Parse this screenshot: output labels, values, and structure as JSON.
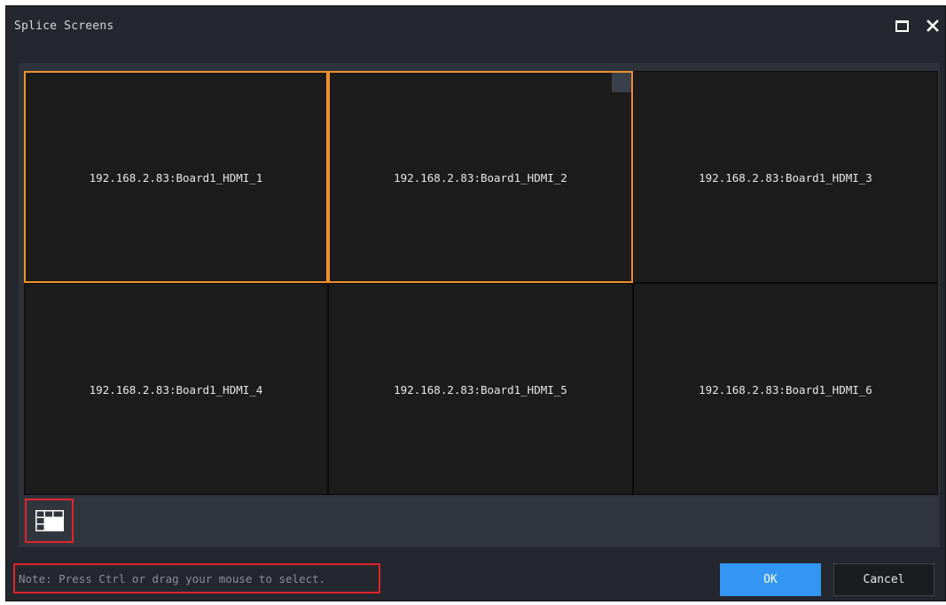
{
  "window": {
    "title": "Splice Screens",
    "maximize_icon": "maximize-icon",
    "close_icon": "close-icon"
  },
  "screens": [
    {
      "label": "192.168.2.83:Board1_HDMI_1",
      "selected": true
    },
    {
      "label": "192.168.2.83:Board1_HDMI_2",
      "selected": true
    },
    {
      "label": "192.168.2.83:Board1_HDMI_3",
      "selected": false
    },
    {
      "label": "192.168.2.83:Board1_HDMI_4",
      "selected": false
    },
    {
      "label": "192.168.2.83:Board1_HDMI_5",
      "selected": false
    },
    {
      "label": "192.168.2.83:Board1_HDMI_6",
      "selected": false
    }
  ],
  "toolbar": {
    "layout_icon": "splice-layout-icon"
  },
  "footer": {
    "note": "Note: Press Ctrl or drag your mouse to select.",
    "ok_label": "OK",
    "cancel_label": "Cancel"
  },
  "colors": {
    "selection": "#f0902a",
    "primary_button": "#3296f2",
    "highlight_box": "#e2232a"
  }
}
